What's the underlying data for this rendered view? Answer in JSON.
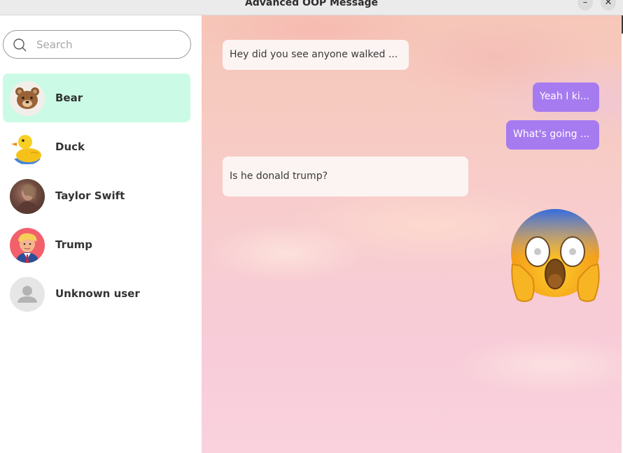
{
  "window": {
    "title": "Advanced OOP Message",
    "minimize_glyph": "–",
    "close_glyph": "✕"
  },
  "sidebar": {
    "search": {
      "placeholder": "Search",
      "value": ""
    },
    "contacts": [
      {
        "name": "Bear",
        "avatar": "bear-icon",
        "selected": true
      },
      {
        "name": "Duck",
        "avatar": "duck-icon",
        "selected": false
      },
      {
        "name": "Taylor Swift",
        "avatar": "photo",
        "selected": false
      },
      {
        "name": "Trump",
        "avatar": "trump-cartoon-icon",
        "selected": false
      },
      {
        "name": "Unknown user",
        "avatar": "default-user-icon",
        "selected": false
      }
    ]
  },
  "chat": {
    "messages": [
      {
        "direction": "incoming",
        "text": "Hey did you see anyone walked ..."
      },
      {
        "direction": "outgoing",
        "text": "Yeah I ki..."
      },
      {
        "direction": "outgoing",
        "text": "What's going ..."
      },
      {
        "direction": "incoming",
        "text": "Is he donald trump?"
      },
      {
        "direction": "outgoing",
        "sticker": "screaming-in-fear-emoji"
      }
    ]
  },
  "colors": {
    "selected_contact_bg": "#cbfbe6",
    "outgoing_bubble": "#a77bf0",
    "incoming_bubble": "#fcf4f3"
  }
}
